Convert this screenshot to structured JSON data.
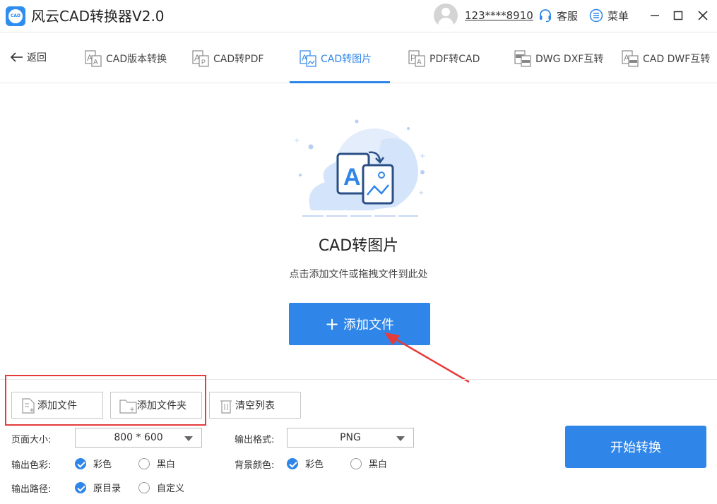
{
  "app": {
    "title": "风云CAD转换器V2.0",
    "logo_text": "CAD"
  },
  "header": {
    "username": "123****8910",
    "service_label": "客服",
    "menu_label": "菜单"
  },
  "nav": {
    "back_label": "返回",
    "tabs": [
      {
        "label": "CAD版本转换"
      },
      {
        "label": "CAD转PDF"
      },
      {
        "label": "CAD转图片"
      },
      {
        "label": "PDF转CAD"
      },
      {
        "label": "DWG DXF互转"
      },
      {
        "label": "CAD DWF互转"
      }
    ],
    "active_tab": "CAD转图片"
  },
  "dropzone": {
    "title": "CAD转图片",
    "hint": "点击添加文件或拖拽文件到此处",
    "add_button": "添加文件",
    "glyph": "A"
  },
  "toolbar": {
    "add_file": "添加文件",
    "add_folder": "添加文件夹",
    "clear_list": "清空列表"
  },
  "settings": {
    "page_size_label": "页面大小:",
    "page_size_value": "800 * 600",
    "output_format_label": "输出格式:",
    "output_format_value": "PNG",
    "output_color_label": "输出色彩:",
    "output_color_options": [
      "彩色",
      "黑白"
    ],
    "output_color_selected": "彩色",
    "bg_color_label": "背景颜色:",
    "bg_color_options": [
      "彩色",
      "黑白"
    ],
    "bg_color_selected": "彩色",
    "output_path_label": "输出路径:",
    "output_path_options": [
      "原目录",
      "自定义"
    ],
    "output_path_selected": "原目录"
  },
  "start_button": "开始转换",
  "colors": {
    "accent": "#2f86e8",
    "annotation": "#e63b3b"
  }
}
